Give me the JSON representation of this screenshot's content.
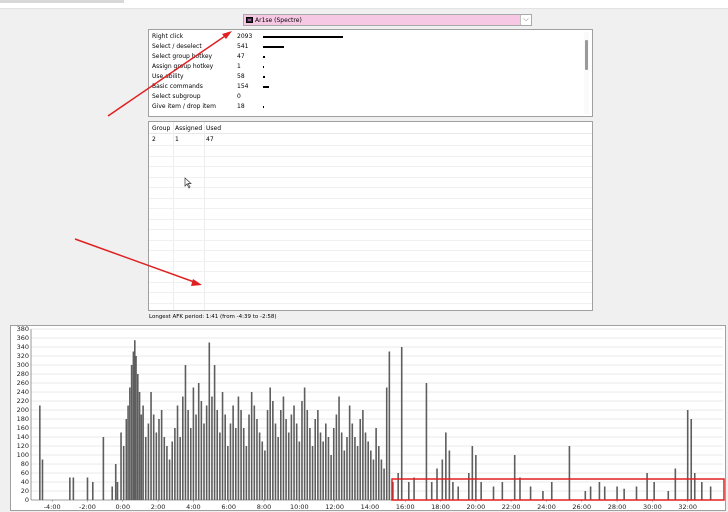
{
  "player_select": {
    "value": "Ar1se (Spectre)",
    "dropdown_glyph": "⌵"
  },
  "hotkey_stats": [
    {
      "label": "Right click",
      "count": "2093",
      "value": 2093
    },
    {
      "label": "Select / deselect",
      "count": "541",
      "value": 541
    },
    {
      "label": "Select group hotkey",
      "count": "47",
      "value": 47
    },
    {
      "label": "Assign group hotkey",
      "count": "1",
      "value": 1
    },
    {
      "label": "Use ability",
      "count": "58",
      "value": 58
    },
    {
      "label": "Basic commands",
      "count": "154",
      "value": 154
    },
    {
      "label": "Select subgroup",
      "count": "0",
      "value": 0
    },
    {
      "label": "Give item / drop item",
      "count": "18",
      "value": 18
    }
  ],
  "group_table": {
    "columns": [
      "Group",
      "Assigned",
      "Used"
    ],
    "rows": [
      [
        "2",
        "1",
        "47"
      ]
    ]
  },
  "afk_text": "Longest AFK period: 1:41 (from -4:39 to -2:58)",
  "annotation_color": "#e02020",
  "chart_data": {
    "type": "bar",
    "title": "",
    "xlabel": "",
    "ylabel": "",
    "xlim": [
      -5.2,
      34.0
    ],
    "ylim": [
      0,
      380
    ],
    "x_unit": "minutes",
    "x_ticks": [
      "-4:00",
      "-2:00",
      "0:00",
      "2:00",
      "4:00",
      "6:00",
      "8:00",
      "10:00",
      "12:00",
      "14:00",
      "16:00",
      "18:00",
      "20:00",
      "22:00",
      "24:00",
      "26:00",
      "28:00",
      "30:00",
      "32:00"
    ],
    "y_ticks": [
      0,
      20,
      40,
      60,
      80,
      100,
      120,
      140,
      160,
      180,
      200,
      220,
      240,
      260,
      280,
      300,
      320,
      340,
      360,
      380
    ],
    "grid": true,
    "series": [
      {
        "values": [
          [
            -4.7,
            210
          ],
          [
            -4.55,
            90
          ],
          [
            -3.0,
            50
          ],
          [
            -2.8,
            50
          ],
          [
            -2.0,
            50
          ],
          [
            -1.7,
            40
          ],
          [
            -1.1,
            140
          ],
          [
            -0.6,
            30
          ],
          [
            -0.4,
            80
          ],
          [
            -0.3,
            40
          ],
          [
            -0.1,
            150
          ],
          [
            0.05,
            120
          ],
          [
            0.2,
            180
          ],
          [
            0.3,
            210
          ],
          [
            0.4,
            250
          ],
          [
            0.5,
            300
          ],
          [
            0.6,
            330
          ],
          [
            0.68,
            355
          ],
          [
            0.75,
            320
          ],
          [
            0.85,
            280
          ],
          [
            0.95,
            240
          ],
          [
            1.05,
            190
          ],
          [
            1.15,
            210
          ],
          [
            1.3,
            140
          ],
          [
            1.45,
            170
          ],
          [
            1.6,
            240
          ],
          [
            1.75,
            190
          ],
          [
            1.9,
            150
          ],
          [
            2.05,
            180
          ],
          [
            2.2,
            200
          ],
          [
            2.35,
            140
          ],
          [
            2.5,
            120
          ],
          [
            2.65,
            90
          ],
          [
            2.8,
            130
          ],
          [
            2.95,
            160
          ],
          [
            3.1,
            210
          ],
          [
            3.25,
            140
          ],
          [
            3.4,
            230
          ],
          [
            3.55,
            300
          ],
          [
            3.7,
            200
          ],
          [
            3.85,
            160
          ],
          [
            4.0,
            250
          ],
          [
            4.15,
            190
          ],
          [
            4.3,
            260
          ],
          [
            4.45,
            220
          ],
          [
            4.6,
            170
          ],
          [
            4.75,
            210
          ],
          [
            4.9,
            350
          ],
          [
            5.05,
            230
          ],
          [
            5.2,
            300
          ],
          [
            5.35,
            200
          ],
          [
            5.5,
            150
          ],
          [
            5.65,
            240
          ],
          [
            5.8,
            190
          ],
          [
            5.95,
            120
          ],
          [
            6.1,
            170
          ],
          [
            6.25,
            210
          ],
          [
            6.4,
            160
          ],
          [
            6.55,
            230
          ],
          [
            6.7,
            200
          ],
          [
            6.85,
            160
          ],
          [
            7.0,
            120
          ],
          [
            7.15,
            190
          ],
          [
            7.3,
            240
          ],
          [
            7.45,
            210
          ],
          [
            7.6,
            180
          ],
          [
            7.75,
            150
          ],
          [
            7.9,
            130
          ],
          [
            8.05,
            110
          ],
          [
            8.2,
            200
          ],
          [
            8.35,
            250
          ],
          [
            8.5,
            220
          ],
          [
            8.65,
            170
          ],
          [
            8.8,
            140
          ],
          [
            8.95,
            200
          ],
          [
            9.1,
            230
          ],
          [
            9.25,
            180
          ],
          [
            9.4,
            150
          ],
          [
            9.55,
            190
          ],
          [
            9.7,
            210
          ],
          [
            9.85,
            170
          ],
          [
            10.0,
            130
          ],
          [
            10.15,
            220
          ],
          [
            10.3,
            250
          ],
          [
            10.45,
            200
          ],
          [
            10.6,
            160
          ],
          [
            10.75,
            120
          ],
          [
            10.9,
            180
          ],
          [
            11.05,
            200
          ],
          [
            11.2,
            150
          ],
          [
            11.35,
            130
          ],
          [
            11.5,
            170
          ],
          [
            11.65,
            140
          ],
          [
            11.8,
            100
          ],
          [
            11.95,
            160
          ],
          [
            12.1,
            190
          ],
          [
            12.25,
            230
          ],
          [
            12.4,
            150
          ],
          [
            12.55,
            110
          ],
          [
            12.7,
            140
          ],
          [
            12.85,
            210
          ],
          [
            13.0,
            170
          ],
          [
            13.15,
            140
          ],
          [
            13.3,
            120
          ],
          [
            13.45,
            180
          ],
          [
            13.6,
            200
          ],
          [
            13.75,
            150
          ],
          [
            13.9,
            130
          ],
          [
            14.05,
            110
          ],
          [
            14.2,
            90
          ],
          [
            14.35,
            160
          ],
          [
            14.5,
            120
          ],
          [
            14.65,
            90
          ],
          [
            14.8,
            70
          ],
          [
            14.95,
            250
          ],
          [
            15.1,
            330
          ],
          [
            15.3,
            40
          ],
          [
            15.6,
            60
          ],
          [
            15.8,
            340
          ],
          [
            16.2,
            40
          ],
          [
            16.5,
            50
          ],
          [
            17.2,
            260
          ],
          [
            17.5,
            40
          ],
          [
            17.8,
            70
          ],
          [
            18.1,
            90
          ],
          [
            18.3,
            150
          ],
          [
            18.5,
            110
          ],
          [
            18.7,
            40
          ],
          [
            19.0,
            30
          ],
          [
            19.6,
            60
          ],
          [
            19.8,
            120
          ],
          [
            20.0,
            100
          ],
          [
            20.3,
            40
          ],
          [
            21.0,
            30
          ],
          [
            21.5,
            40
          ],
          [
            22.2,
            100
          ],
          [
            22.5,
            50
          ],
          [
            23.1,
            30
          ],
          [
            23.8,
            20
          ],
          [
            24.3,
            40
          ],
          [
            25.3,
            120
          ],
          [
            26.2,
            20
          ],
          [
            26.5,
            30
          ],
          [
            27.0,
            40
          ],
          [
            27.3,
            30
          ],
          [
            28.0,
            30
          ],
          [
            28.4,
            25
          ],
          [
            29.1,
            30
          ],
          [
            29.7,
            60
          ],
          [
            30.1,
            40
          ],
          [
            30.9,
            20
          ],
          [
            31.3,
            70
          ],
          [
            32.0,
            200
          ],
          [
            32.2,
            180
          ],
          [
            32.4,
            60
          ],
          [
            32.8,
            40
          ],
          [
            33.3,
            30
          ]
        ]
      }
    ]
  }
}
